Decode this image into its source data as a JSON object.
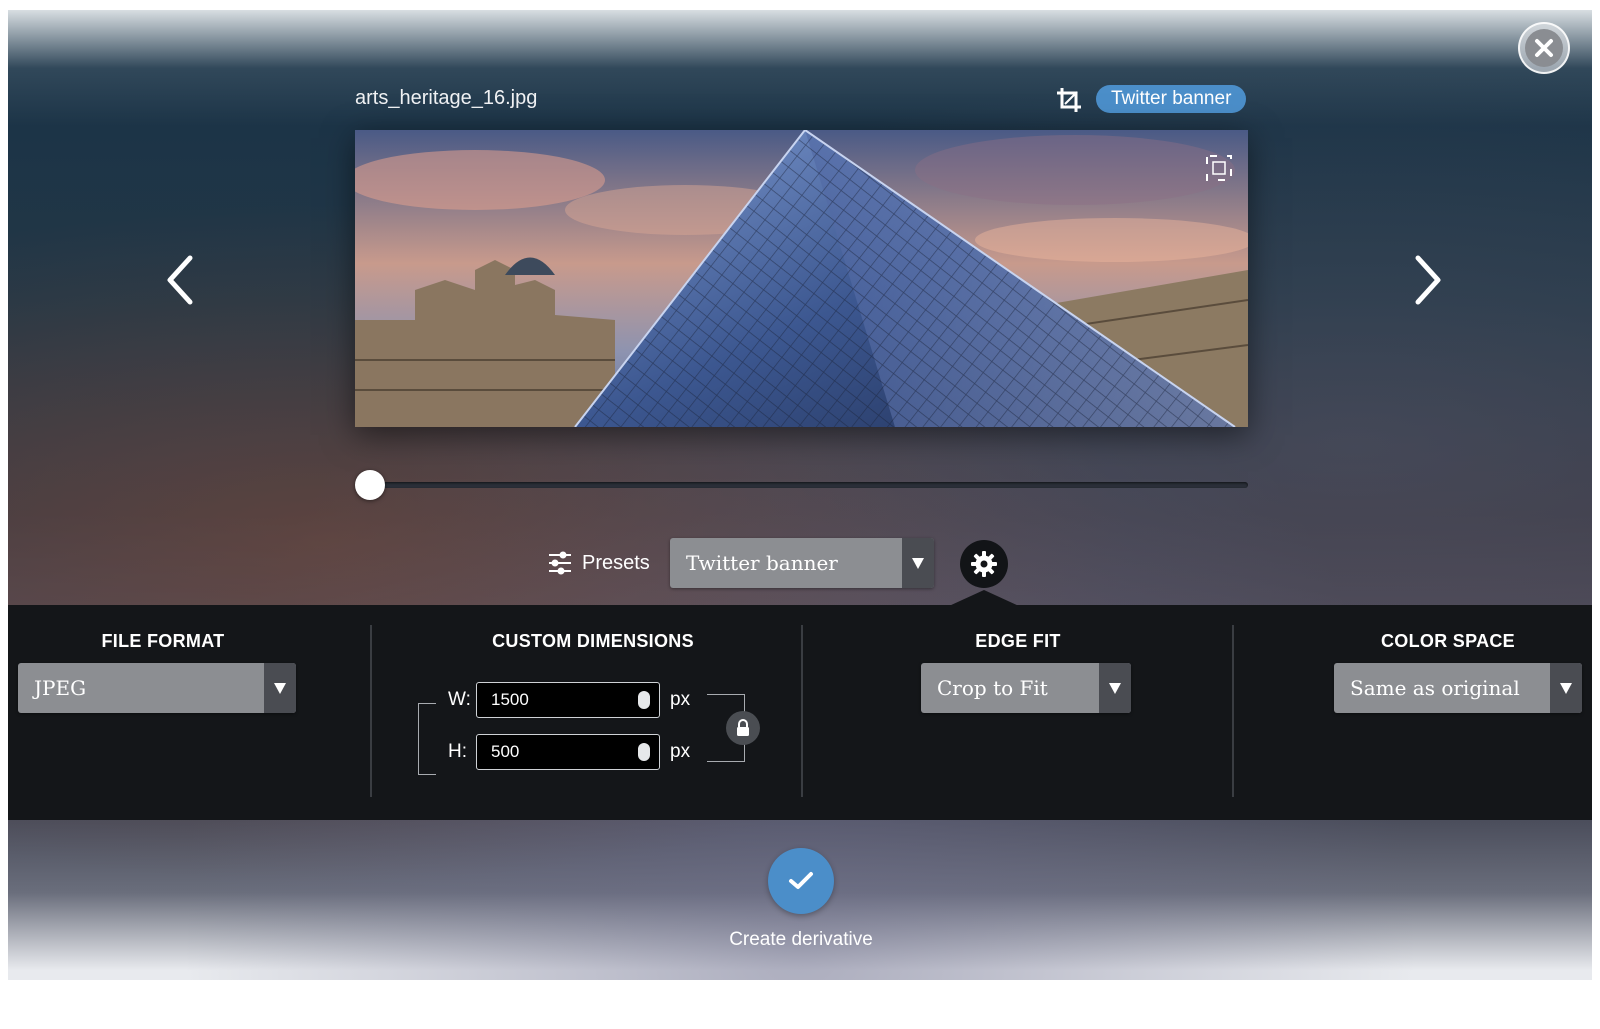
{
  "window": {
    "close_icon": "close-circle-icon"
  },
  "header": {
    "filename": "arts_heritage_16.jpg",
    "crop_icon": "crop-icon",
    "preset_badge": "Twitter banner"
  },
  "preview": {
    "image_description_icon": "focus-point-icon"
  },
  "navigation": {
    "prev_icon": "chevron-left-icon",
    "next_icon": "chevron-right-icon"
  },
  "zoom_slider": {
    "value": 0
  },
  "toolbar": {
    "presets_label": "Presets",
    "presets_icon": "sliders-icon",
    "preset_selected": "Twitter banner",
    "settings_icon": "gear-icon"
  },
  "settings": {
    "file_format": {
      "title": "FILE FORMAT",
      "selected": "JPEG"
    },
    "custom_dimensions": {
      "title": "CUSTOM DIMENSIONS",
      "width_label": "W:",
      "width_value": "1500",
      "height_label": "H:",
      "height_value": "500",
      "unit": "px",
      "lock_icon": "lock-icon"
    },
    "edge_fit": {
      "title": "EDGE FIT",
      "selected": "Crop to Fit"
    },
    "color_space": {
      "title": "COLOR SPACE",
      "selected": "Same as original"
    }
  },
  "actions": {
    "create_label": "Create derivative",
    "create_icon": "checkmark-icon"
  },
  "colors": {
    "accent": "#4b8ec9",
    "panel": "#141619",
    "select_bg": "#8c8e92"
  }
}
